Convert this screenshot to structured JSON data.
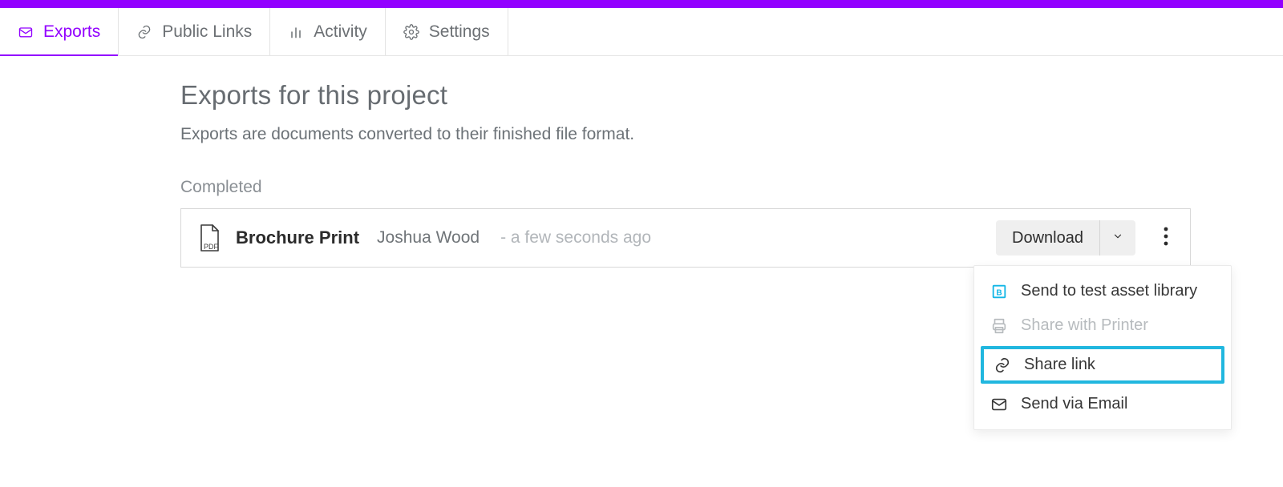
{
  "tabs": {
    "exports": "Exports",
    "public_links": "Public Links",
    "activity": "Activity",
    "settings": "Settings",
    "active": "exports"
  },
  "page": {
    "title": "Exports for this project",
    "description": "Exports are documents converted to their finished file format.",
    "section": "Completed"
  },
  "export_item": {
    "file_type": "PDF",
    "name": "Brochure Print",
    "author": "Joshua Wood",
    "time": "- a few seconds ago",
    "download_label": "Download"
  },
  "menu": {
    "send_asset": "Send to test asset library",
    "share_printer": "Share with Printer",
    "share_link": "Share link",
    "send_email": "Send via Email"
  }
}
